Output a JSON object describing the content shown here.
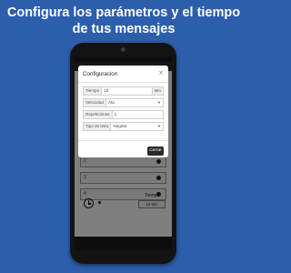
{
  "headline": {
    "line1": "Configura los parámetros y el tiempo",
    "line2": "de tus mensajes"
  },
  "modal": {
    "title": "Configuracion",
    "close_icon": "close-icon",
    "close_glyph": "×",
    "fields": [
      {
        "label": "Tiempo",
        "value": "15",
        "suffix": "Min"
      },
      {
        "label": "Velocidad",
        "value": "Ata",
        "type": "select"
      },
      {
        "label": "Repeticiones",
        "value": "1"
      },
      {
        "label": "Tipo de letra",
        "value": "Negrita",
        "type": "select"
      }
    ],
    "close_button": "Cerrar"
  },
  "background_app": {
    "rows": [
      {
        "label": "2"
      },
      {
        "label": "3"
      },
      {
        "label": "4"
      }
    ],
    "timer_label": "Tiempo",
    "timer_value": "15 Min"
  }
}
